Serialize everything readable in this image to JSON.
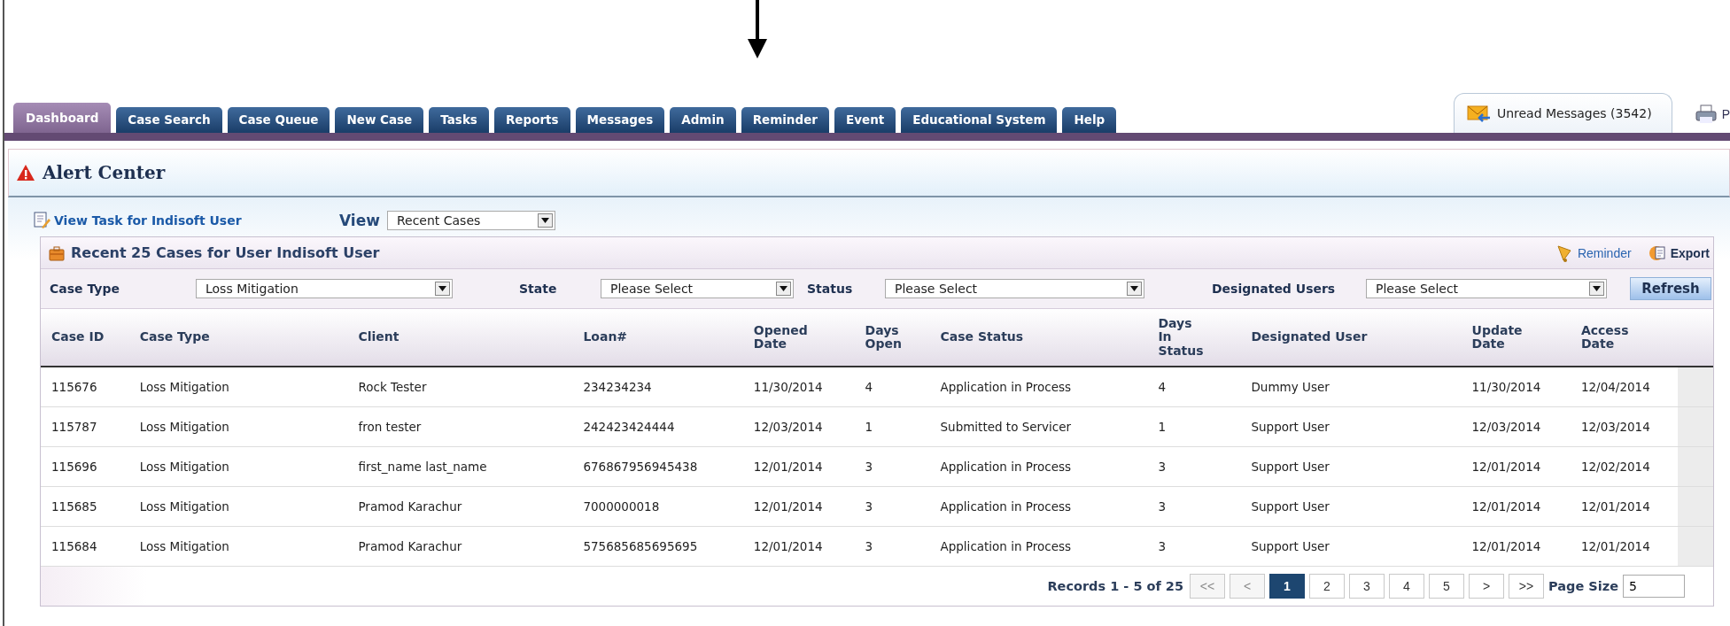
{
  "tabs": [
    {
      "label": "Dashboard",
      "selected": true
    },
    {
      "label": "Case Search",
      "selected": false
    },
    {
      "label": "Case Queue",
      "selected": false
    },
    {
      "label": "New Case",
      "selected": false
    },
    {
      "label": "Tasks",
      "selected": false
    },
    {
      "label": "Reports",
      "selected": false
    },
    {
      "label": "Messages",
      "selected": false
    },
    {
      "label": "Admin",
      "selected": false
    },
    {
      "label": "Reminder",
      "selected": false
    },
    {
      "label": "Event",
      "selected": false
    },
    {
      "label": "Educational System",
      "selected": false
    },
    {
      "label": "Help",
      "selected": false
    }
  ],
  "unread_messages": "Unread Messages (3542)",
  "print_link": "P",
  "alert_center": {
    "title": "Alert Center"
  },
  "view_task_link": "View Task for Indisoft User",
  "view": {
    "label": "View",
    "value": "Recent Cases"
  },
  "panel": {
    "title": "Recent 25 Cases for User Indisoft User",
    "actions": [
      {
        "label": "Reminder",
        "kind": "reminder"
      },
      {
        "label": "Export",
        "kind": "export"
      }
    ]
  },
  "filters": [
    {
      "label": "Case Type",
      "value": "Loss Mitigation"
    },
    {
      "label": "State",
      "value": "Please Select"
    },
    {
      "label": "Status",
      "value": "Please Select"
    },
    {
      "label": "Designated Users",
      "value": "Please Select"
    }
  ],
  "refresh_button": "Refresh",
  "table": {
    "columns": [
      "Case ID",
      "Case Type",
      "Client",
      "Loan#",
      "Opened Date",
      "Days Open",
      "Case Status",
      "Days In Status",
      "Designated User",
      "Update Date",
      "Access Date"
    ],
    "rows": [
      [
        "115676",
        "Loss Mitigation",
        "Rock Tester",
        "234234234",
        "11/30/2014",
        "4",
        "Application in Process",
        "4",
        "Dummy User",
        "11/30/2014",
        "12/04/2014"
      ],
      [
        "115787",
        "Loss Mitigation",
        "fron tester",
        "242423424444",
        "12/03/2014",
        "1",
        "Submitted to Servicer",
        "1",
        "Support User",
        "12/03/2014",
        "12/03/2014"
      ],
      [
        "115696",
        "Loss Mitigation",
        "first_name last_name",
        "676867956945438",
        "12/01/2014",
        "3",
        "Application in Process",
        "3",
        "Support User",
        "12/01/2014",
        "12/02/2014"
      ],
      [
        "115685",
        "Loss Mitigation",
        "Pramod Karachur",
        "7000000018",
        "12/01/2014",
        "3",
        "Application in Process",
        "3",
        "Support User",
        "12/01/2014",
        "12/01/2014"
      ],
      [
        "115684",
        "Loss Mitigation",
        "Pramod Karachur",
        "575685685695695",
        "12/01/2014",
        "3",
        "Application in Process",
        "3",
        "Support User",
        "12/01/2014",
        "12/01/2014"
      ]
    ]
  },
  "pager": {
    "records": "Records 1 - 5 of 25",
    "pages": [
      {
        "label": "<<",
        "disabled": true,
        "selected": false
      },
      {
        "label": "<",
        "disabled": true,
        "selected": false
      },
      {
        "label": "1",
        "disabled": false,
        "selected": true
      },
      {
        "label": "2",
        "disabled": false,
        "selected": false
      },
      {
        "label": "3",
        "disabled": false,
        "selected": false
      },
      {
        "label": "4",
        "disabled": false,
        "selected": false
      },
      {
        "label": "5",
        "disabled": false,
        "selected": false
      },
      {
        "label": ">",
        "disabled": false,
        "selected": false
      },
      {
        "label": ">>",
        "disabled": false,
        "selected": false
      }
    ],
    "page_size_label": "Page Size",
    "page_size": "5"
  }
}
